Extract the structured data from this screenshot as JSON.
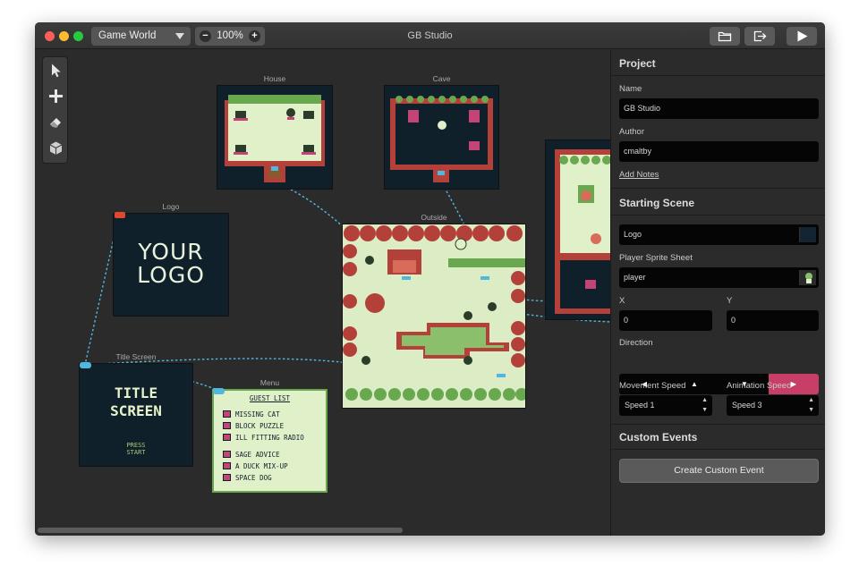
{
  "titlebar": {
    "world_select": "Game World",
    "zoom": "100%",
    "zoom_minus": "−",
    "zoom_plus": "+",
    "app_title": "GB Studio"
  },
  "scenes": {
    "house": "House",
    "cave": "Cave",
    "logo": "Logo",
    "outside": "Outside",
    "title_screen": "Title Screen",
    "menu": "Menu"
  },
  "logo_art": {
    "line1": "YOUR",
    "line2": "LOGO"
  },
  "title_art": {
    "line1": "TITLE",
    "line2": "SCREEN",
    "press1": "PRESS",
    "press2": "START"
  },
  "menu_art": {
    "heading": "GUEST LIST",
    "items": [
      "MISSING CAT",
      "BLOCK PUZZLE",
      "ILL FITTING RADIO",
      "SAGE ADVICE",
      "A DUCK MIX-UP",
      "SPACE DOG"
    ]
  },
  "sidebar": {
    "project_heading": "Project",
    "name_label": "Name",
    "name_value": "GB Studio",
    "author_label": "Author",
    "author_value": "cmaltby",
    "add_notes": "Add Notes",
    "starting_heading": "Starting Scene",
    "scene_value": "Logo",
    "sprite_label": "Player Sprite Sheet",
    "sprite_value": "player",
    "x_label": "X",
    "x_value": "0",
    "y_label": "Y",
    "y_value": "0",
    "direction_label": "Direction",
    "directions": [
      "◀",
      "▲",
      "▼",
      "▶"
    ],
    "movement_label": "Movement Speed",
    "movement_value": "Speed 1",
    "animation_label": "Animation Speed",
    "animation_value": "Speed 3",
    "custom_heading": "Custom Events",
    "create_button": "Create Custom Event"
  },
  "colors": {
    "accent": "#c73f66",
    "connection": "#4fb8e0",
    "gb_dark": "#10202b",
    "gb_light": "#e0f0c8"
  }
}
